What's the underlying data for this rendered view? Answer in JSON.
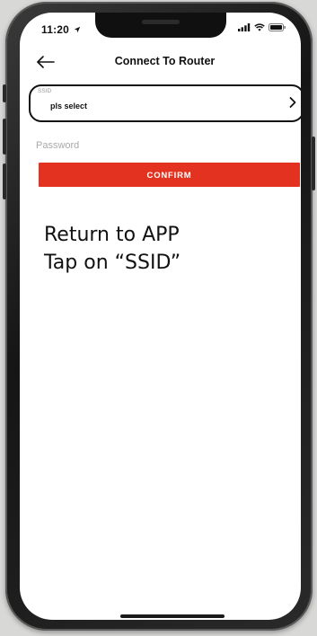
{
  "status_bar": {
    "time": "11:20",
    "icons": [
      "location-arrow-icon",
      "cellular-signal-icon",
      "wifi-icon",
      "battery-icon"
    ]
  },
  "nav": {
    "back_icon": "arrow-left-icon",
    "title": "Connect To Router"
  },
  "ssid": {
    "label": "SSID",
    "value": "pls select",
    "chevron_icon": "chevron-right-icon"
  },
  "password": {
    "placeholder": "Password",
    "value": ""
  },
  "confirm": {
    "label": "CONFIRM",
    "color": "#e3321f"
  },
  "instructions": {
    "line1": "Return to APP",
    "line2": "Tap on “SSID”"
  }
}
